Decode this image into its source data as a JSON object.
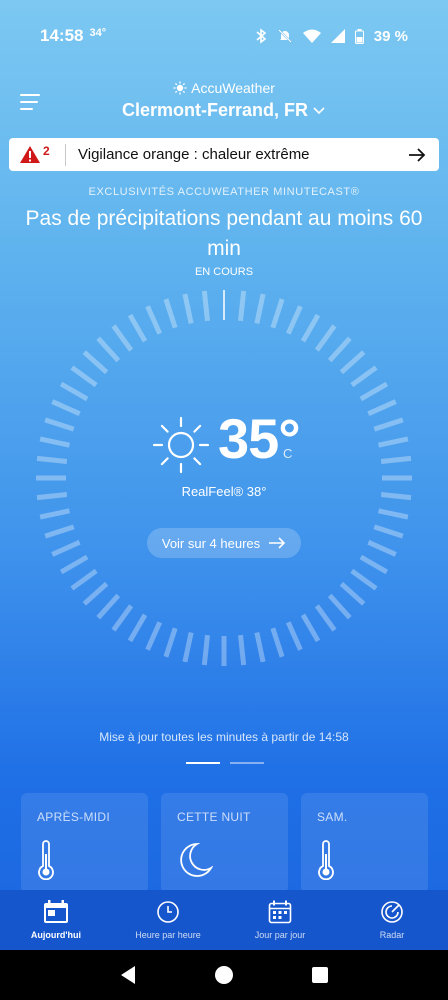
{
  "status": {
    "time": "14:58",
    "temp": "34°",
    "battery": "39 %"
  },
  "header": {
    "brand": "AccuWeather",
    "city": "Clermont-Ferrand, FR"
  },
  "alert": {
    "level": "2",
    "text": "Vigilance orange : chaleur extrême",
    "color": "#d01818"
  },
  "minutecast": {
    "label": "EXCLUSIVITÉS ACCUWEATHER MINUTECAST®",
    "summary": "Pas de précipitations pendant au moins 60 min",
    "now_label": "EN COURS"
  },
  "current": {
    "icon": "sun-icon",
    "temperature": "35°",
    "unit": "C",
    "realfeel": "RealFeel® 38°",
    "hours_button": "Voir sur 4 heures"
  },
  "update_text": "Mise à jour toutes les minutes à partir de 14:58",
  "pager": {
    "pages": 2,
    "active": 1
  },
  "cards": [
    {
      "title": "APRÈS-MIDI",
      "icon": "thermometer-icon"
    },
    {
      "title": "CETTE NUIT",
      "icon": "moon-icon"
    },
    {
      "title": "SAM.",
      "icon": "thermometer-icon"
    }
  ],
  "tabs": [
    {
      "label": "Aujourd'hui",
      "icon": "calendar-today-icon",
      "active": true
    },
    {
      "label": "Heure par heure",
      "icon": "clock-icon",
      "active": false
    },
    {
      "label": "Jour par jour",
      "icon": "calendar-days-icon",
      "active": false
    },
    {
      "label": "Radar",
      "icon": "radar-icon",
      "active": false
    }
  ],
  "colors": {
    "tabbar": "#1656cc",
    "alert_background": "#ffffff"
  }
}
